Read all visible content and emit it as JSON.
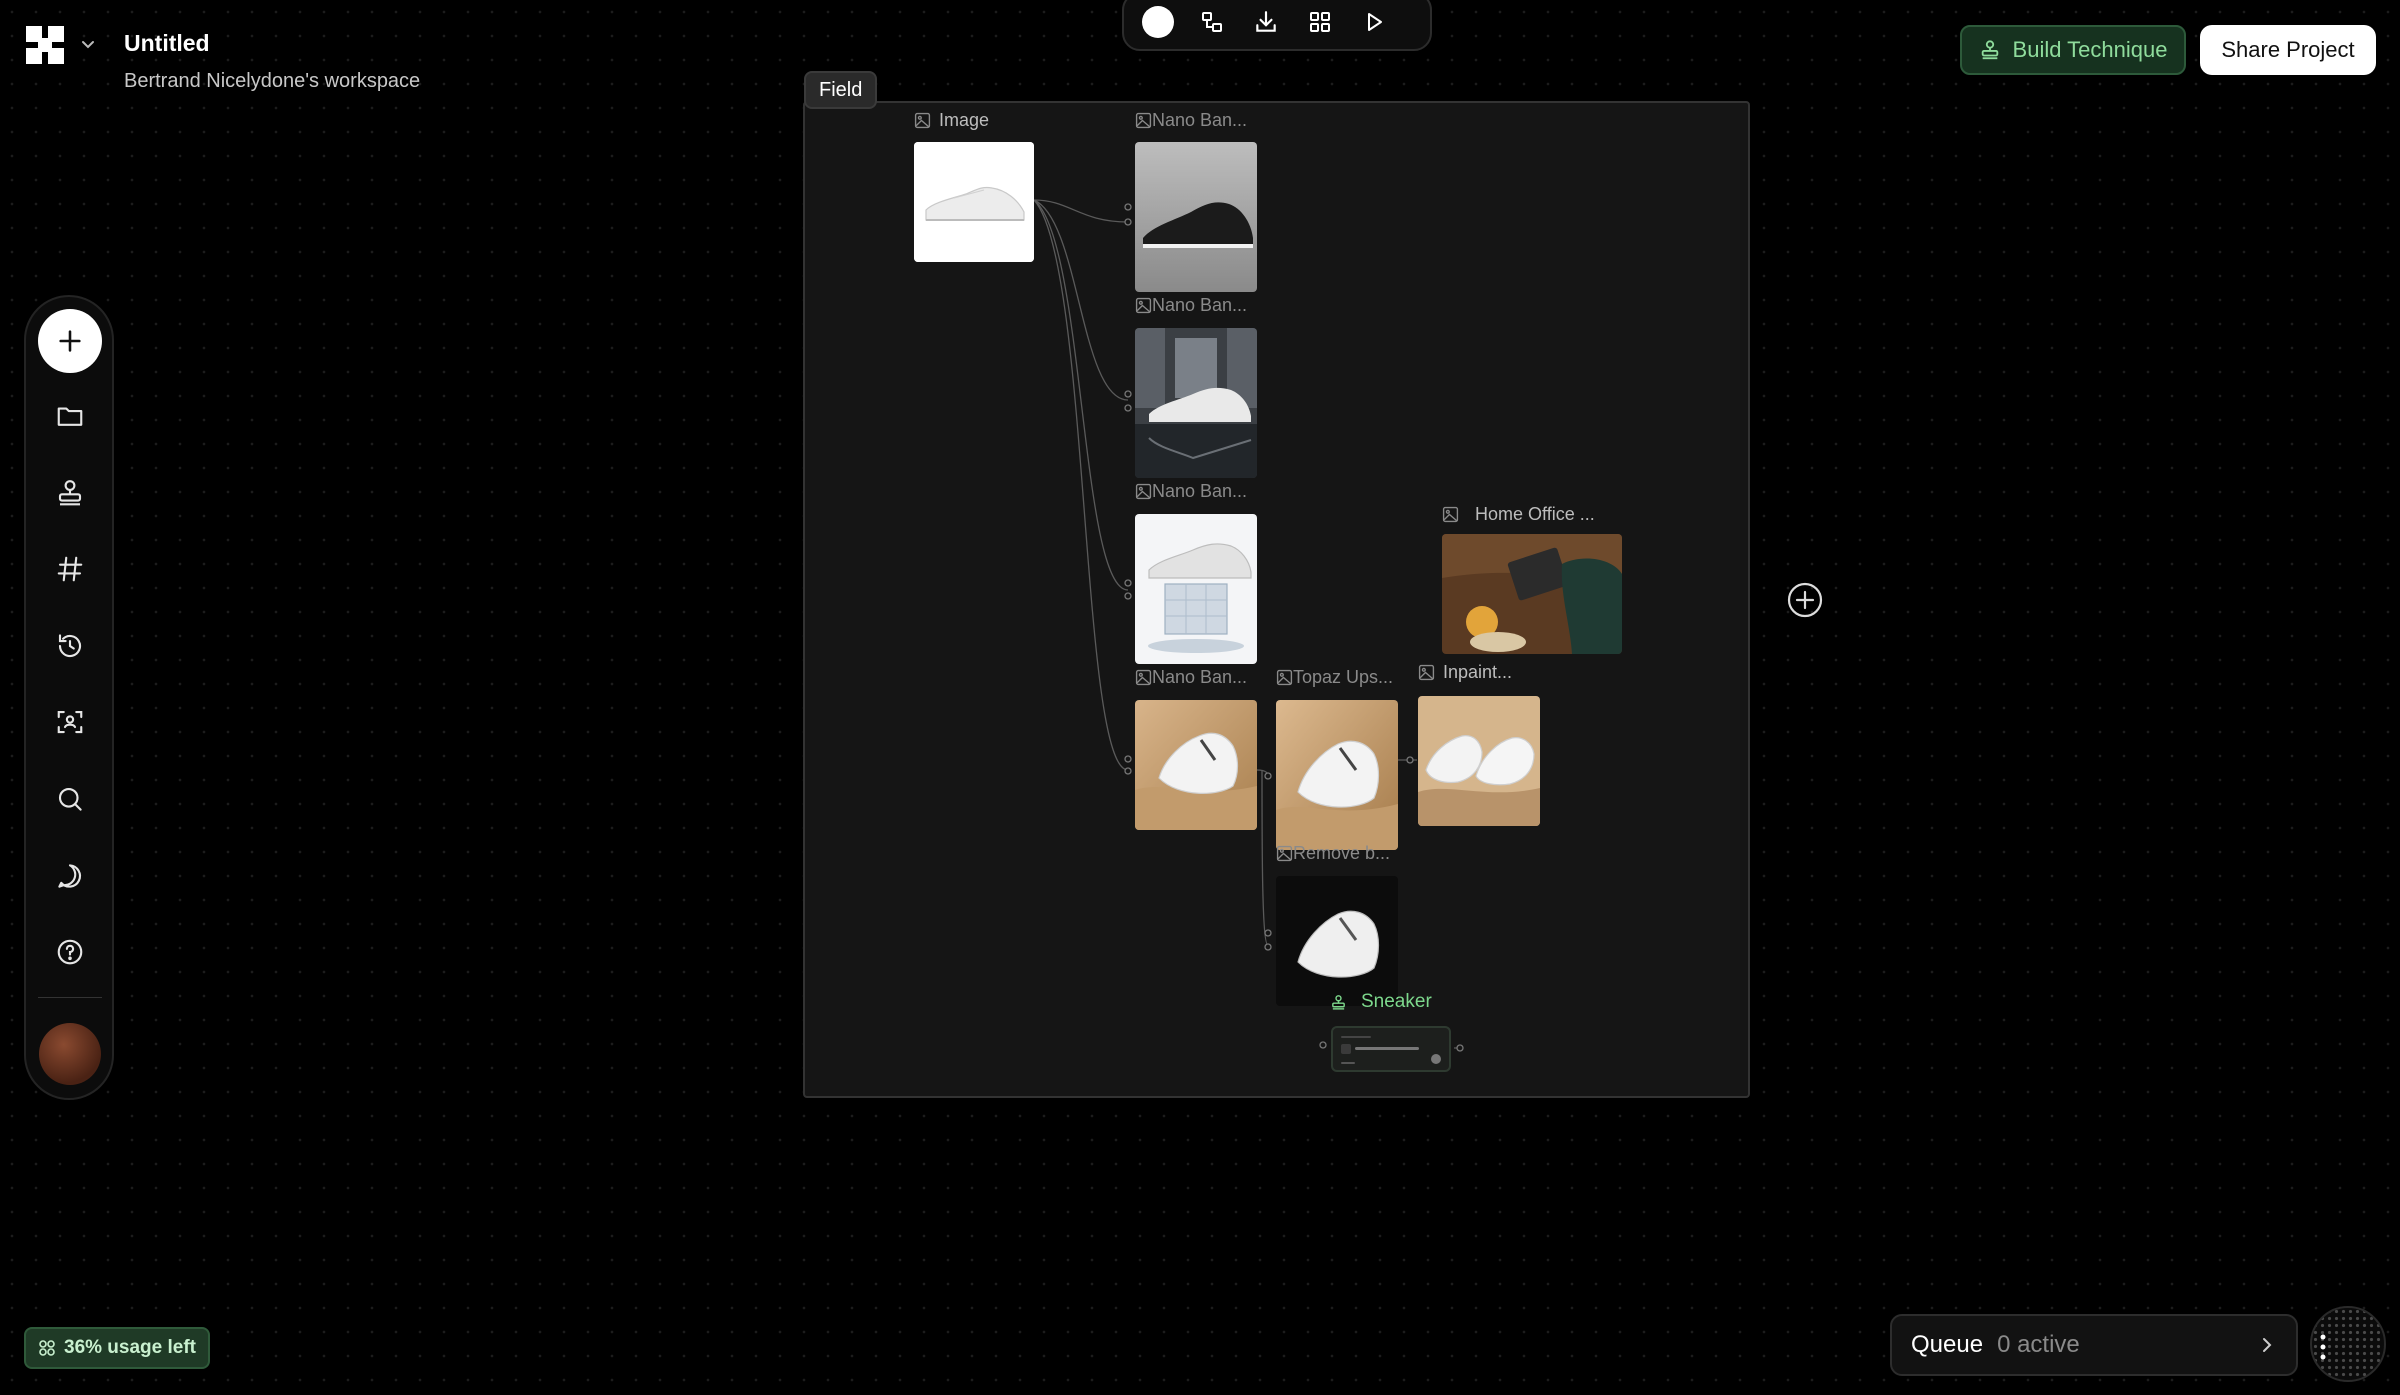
{
  "header": {
    "title": "Untitled",
    "workspace": "Bertrand Nicelydone's workspace"
  },
  "toolbar": {
    "icons": [
      "color-dot",
      "layout-icon",
      "download-icon",
      "grid-icon",
      "play-icon"
    ]
  },
  "actions": {
    "build_label": "Build Technique",
    "share_label": "Share Project"
  },
  "sidebar": {
    "items": [
      "add",
      "folder",
      "stamp",
      "hash",
      "history",
      "scan",
      "search",
      "chat",
      "help"
    ]
  },
  "canvas": {
    "group_label": "Field",
    "nodes": {
      "image": "Image",
      "nano1": "Nano Ban...",
      "nano2": "Nano Ban...",
      "nano3": "Nano Ban...",
      "nano4": "Nano Ban...",
      "topaz": "Topaz Ups...",
      "inpaint": "Inpaint...",
      "home_office": "Home Office ...",
      "remove_bg": "Remove b...",
      "sneaker": "Sneaker"
    }
  },
  "usage": {
    "label": "36% usage left"
  },
  "queue": {
    "label": "Queue",
    "count": "0 active"
  },
  "colors": {
    "accent_green": "#7dd88c",
    "build_bg": "#16321f",
    "usage_bg": "#1f3a26"
  }
}
